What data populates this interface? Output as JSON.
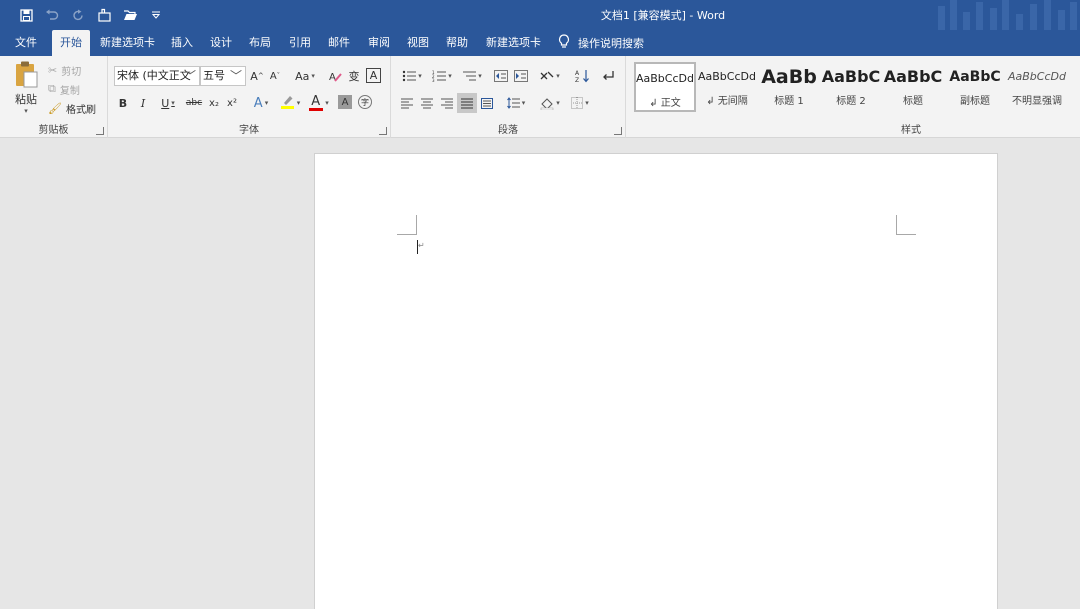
{
  "window": {
    "title": "文档1 [兼容模式] - Word"
  },
  "qat": {
    "icons": [
      "save-icon",
      "undo-icon",
      "redo-icon",
      "touch-mode-icon",
      "open-icon",
      "customize-qat-icon"
    ]
  },
  "tabs": [
    {
      "label": "文件"
    },
    {
      "label": "开始",
      "active": true
    },
    {
      "label": "新建选项卡"
    },
    {
      "label": "插入"
    },
    {
      "label": "设计"
    },
    {
      "label": "布局"
    },
    {
      "label": "引用"
    },
    {
      "label": "邮件"
    },
    {
      "label": "审阅"
    },
    {
      "label": "视图"
    },
    {
      "label": "帮助"
    },
    {
      "label": "新建选项卡"
    }
  ],
  "tell_me": {
    "label": "操作说明搜索"
  },
  "clipboard": {
    "group_label": "剪贴板",
    "paste": "粘贴",
    "cut": "剪切",
    "copy": "复制",
    "format_painter": "格式刷"
  },
  "font": {
    "group_label": "字体",
    "font_name": "宋体 (中文正文",
    "font_size": "五号",
    "change_case": "Aa",
    "bold": "B",
    "italic": "I",
    "underline": "U",
    "strikethrough": "abc",
    "subscript": "x₂",
    "superscript": "x²",
    "font_color": "A",
    "phonetic": "变",
    "char_border": "A",
    "char_shading": "A",
    "enclosed": "字"
  },
  "paragraph": {
    "group_label": "段落"
  },
  "styles": {
    "group_label": "样式",
    "items": [
      {
        "sample": "AaBbCcDd",
        "name": "↲ 正文",
        "active": true
      },
      {
        "sample": "AaBbCcDd",
        "name": "↲ 无间隔"
      },
      {
        "sample": "AaBb",
        "name": "标题 1"
      },
      {
        "sample": "AaBbC",
        "name": "标题 2"
      },
      {
        "sample": "AaBbC",
        "name": "标题"
      },
      {
        "sample": "AaBbC",
        "name": "副标题"
      },
      {
        "sample": "AaBbCcDd",
        "name": "不明显强调"
      }
    ]
  },
  "colors": {
    "accent": "#2b579a",
    "ribbon_bg": "#f3f3f3",
    "canvas_bg": "#e6e6e6",
    "highlight": "#ffff00",
    "font_color": "#e00000"
  }
}
